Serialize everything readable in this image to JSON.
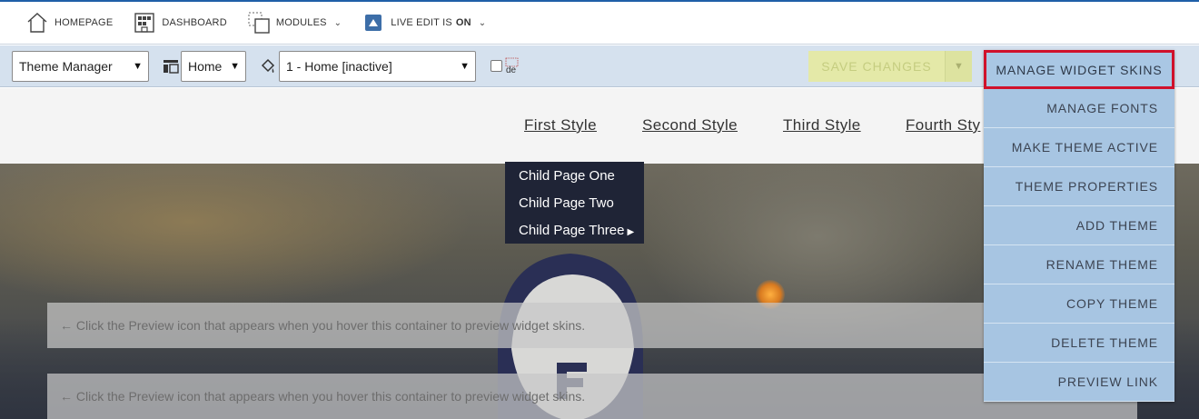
{
  "topbar": {
    "homepage": "HOMEPAGE",
    "dashboard": "DASHBOARD",
    "modules": "MODULES",
    "live_edit_label": "LIVE EDIT IS",
    "live_edit_state": "ON"
  },
  "toolbar": {
    "theme_select": "Theme Manager",
    "page_select": "Home",
    "theme_version_select": "1 - Home [inactive]",
    "checkbox_label": "de",
    "save_label": "SAVE CHANGES"
  },
  "nav": {
    "links": [
      "First Style",
      "Second Style",
      "Third Style",
      "Fourth Sty"
    ],
    "children": [
      "Child Page One",
      "Child Page Two",
      "Child Page Three"
    ]
  },
  "widgets": {
    "box1": "← Click the Preview icon that appears when you hover this container to preview widget skins.",
    "box2": "← Click the Preview icon that appears when you hover this container to preview widget skins."
  },
  "manage_menu": [
    "MANAGE WIDGET SKINS",
    "MANAGE FONTS",
    "MAKE THEME ACTIVE",
    "THEME PROPERTIES",
    "ADD THEME",
    "RENAME THEME",
    "COPY THEME",
    "DELETE THEME",
    "PREVIEW LINK"
  ],
  "colors": {
    "toolbar_bg": "#d5e1ee",
    "menu_bg": "#a7c5e2",
    "highlight": "#d0112b",
    "save_bg": "#e4e9a8",
    "child_menu_bg": "#1f2436"
  }
}
